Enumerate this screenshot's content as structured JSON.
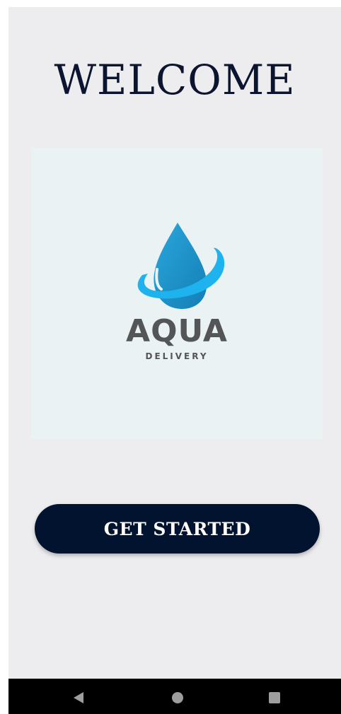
{
  "welcome": {
    "title": "WELCOME"
  },
  "logo": {
    "brand_name": "AQUA",
    "tagline": "DELIVERY",
    "colors": {
      "drop_dark": "#1a8fc4",
      "drop_light": "#2aaee8",
      "ring": "#1eb3ef",
      "text": "#545556"
    }
  },
  "cta": {
    "label": "GET STARTED",
    "background": "#021330"
  },
  "navigation": {
    "back_icon": "back-triangle-icon",
    "home_icon": "home-circle-icon",
    "recents_icon": "recents-square-icon"
  },
  "colors": {
    "screen_background": "#edecee",
    "logo_card_background": "#eaf2f4",
    "title_color": "#0c1530"
  }
}
